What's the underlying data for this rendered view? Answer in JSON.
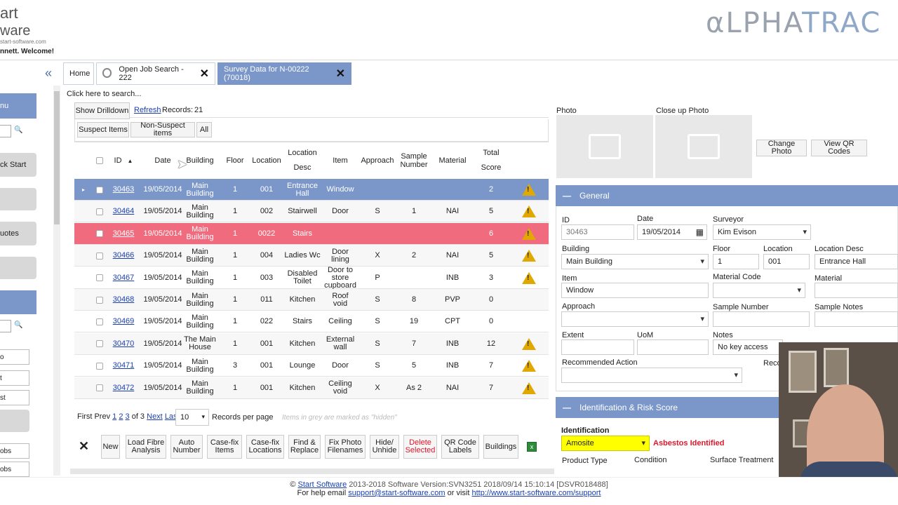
{
  "header": {
    "logo_line1": "art",
    "logo_line2": "ware",
    "logo_url": "start-software.com",
    "welcome": "nnett. Welcome!",
    "brand_a": "αLPHA",
    "brand_b": "TRAC"
  },
  "tabs": [
    {
      "label": "Home"
    },
    {
      "label": "Open Job Search - 222"
    },
    {
      "label": "Survey Data for N-00222 (70018)"
    }
  ],
  "sidebar": {
    "menu_label": "nu",
    "quick_start": "ck Start",
    "quotes": "uotes",
    "item1": "o",
    "item2": "t",
    "item3": "st",
    "item4": "obs",
    "item5": "obs"
  },
  "toolbar": {
    "click_search": "Click here to search...",
    "show_drilldown": "Show Drilldown",
    "refresh": "Refresh",
    "records_label": "Records:",
    "records_count": "21",
    "filter_suspect": "Suspect Items",
    "filter_nonsuspect": "Non-Suspect items",
    "filter_all": "All"
  },
  "table": {
    "headers": {
      "id": "ID",
      "date": "Date",
      "building": "Building",
      "floor": "Floor",
      "location": "Location",
      "location_desc": "Location Desc",
      "item": "Item",
      "approach": "Approach",
      "sample": "Sample Number",
      "material": "Material",
      "score": "Total Score"
    },
    "rows": [
      {
        "id": "30463",
        "date": "19/05/2014",
        "building": "Main Building",
        "floor": "1",
        "location": "001",
        "desc": "Entrance Hall",
        "item": "Window",
        "approach": "",
        "sample": "",
        "material": "",
        "score": "2",
        "warn": true
      },
      {
        "id": "30464",
        "date": "19/05/2014",
        "building": "Main Building",
        "floor": "1",
        "location": "002",
        "desc": "Stairwell",
        "item": "Door",
        "approach": "S",
        "sample": "1",
        "material": "NAI",
        "score": "5",
        "warn": true
      },
      {
        "id": "30465",
        "date": "19/05/2014",
        "building": "Main Building",
        "floor": "1",
        "location": "0022",
        "desc": "Stairs",
        "item": "",
        "approach": "",
        "sample": "",
        "material": "",
        "score": "6",
        "warn": true
      },
      {
        "id": "30466",
        "date": "19/05/2014",
        "building": "Main Building",
        "floor": "1",
        "location": "004",
        "desc": "Ladies Wc",
        "item": "Door lining",
        "approach": "X",
        "sample": "2",
        "material": "NAI",
        "score": "5",
        "warn": true
      },
      {
        "id": "30467",
        "date": "19/05/2014",
        "building": "Main Building",
        "floor": "1",
        "location": "003",
        "desc": "Disabled Toilet",
        "item": "Door to store cupboard",
        "approach": "P",
        "sample": "",
        "material": "INB",
        "score": "3",
        "warn": true
      },
      {
        "id": "30468",
        "date": "19/05/2014",
        "building": "Main Building",
        "floor": "1",
        "location": "011",
        "desc": "Kitchen",
        "item": "Roof void",
        "approach": "S",
        "sample": "8",
        "material": "PVP",
        "score": "0",
        "warn": false
      },
      {
        "id": "30469",
        "date": "19/05/2014",
        "building": "Main Building",
        "floor": "1",
        "location": "022",
        "desc": "Stairs",
        "item": "Ceiling",
        "approach": "S",
        "sample": "19",
        "material": "CPT",
        "score": "0",
        "warn": false
      },
      {
        "id": "30470",
        "date": "19/05/2014",
        "building": "The Main House",
        "floor": "1",
        "location": "001",
        "desc": "Kitchen",
        "item": "External wall",
        "approach": "S",
        "sample": "7",
        "material": "INB",
        "score": "12",
        "warn": true
      },
      {
        "id": "30471",
        "date": "19/05/2014",
        "building": "Main Building",
        "floor": "3",
        "location": "001",
        "desc": "Lounge",
        "item": "Door",
        "approach": "S",
        "sample": "5",
        "material": "INB",
        "score": "7",
        "warn": true
      },
      {
        "id": "30472",
        "date": "19/05/2014",
        "building": "Main Building",
        "floor": "1",
        "location": "001",
        "desc": "Kitchen",
        "item": "Ceiling void",
        "approach": "X",
        "sample": "As 2",
        "material": "NAI",
        "score": "7",
        "warn": true
      }
    ]
  },
  "pager": {
    "first": "First",
    "prev": "Prev",
    "p1": "1",
    "p2": "2",
    "p3": "3",
    "of": "of 3",
    "next": "Next",
    "last": "Last",
    "per_page_value": "10",
    "per_page_label": "Records per page",
    "hint": "Items in grey are marked as \"hidden\""
  },
  "actions": {
    "new": "New",
    "load_fibre": "Load Fibre Analysis",
    "auto_number": "Auto Number",
    "casefix_items": "Case-fix Items",
    "casefix_locations": "Case-fix Locations",
    "find_replace": "Find & Replace",
    "fix_photo": "Fix Photo Filenames",
    "hide_unhide": "Hide/ Unhide",
    "delete_selected": "Delete Selected",
    "qr_labels": "QR Code Labels",
    "buildings": "Buildings"
  },
  "photos": {
    "photo_label": "Photo",
    "closeup_label": "Close up Photo",
    "change_photo": "Change Photo",
    "view_qr": "View QR Codes"
  },
  "general": {
    "title": "General",
    "id_label": "ID",
    "id_value": "30463",
    "date_label": "Date",
    "date_value": "19/05/2014",
    "surveyor_label": "Surveyor",
    "surveyor_value": "Kim Evison",
    "building_label": "Building",
    "building_value": "Main Building",
    "floor_label": "Floor",
    "floor_value": "1",
    "location_label": "Location",
    "location_value": "001",
    "locdesc_label": "Location Desc",
    "locdesc_value": "Entrance Hall",
    "item_label": "Item",
    "item_value": "Window",
    "matcode_label": "Material Code",
    "material_label": "Material",
    "approach_label": "Approach",
    "sample_label": "Sample Number",
    "samplenotes_label": "Sample Notes",
    "extent_label": "Extent",
    "uom_label": "UoM",
    "notes_label": "Notes",
    "notes_value": "No key access",
    "recaction_label": "Recommended Action",
    "reco_label": "Reco"
  },
  "identification": {
    "title": "Identification & Risk Score",
    "ident_label": "Identification",
    "ident_value": "Amosite",
    "status": "Asbestos Identified",
    "product_label": "Product Type",
    "condition_label": "Condition",
    "surface_label": "Surface Treatment"
  },
  "footer": {
    "copyright": "©",
    "company": "Start Software",
    "line1_rest": "2013-2018 Software Version:SVN3251 2018/09/14 15:10:14 [DSVR018488]",
    "help_text": "For help email",
    "email": "support@start-software.com",
    "or_visit": "or visit",
    "url": "http://www.start-software.com/support"
  },
  "colors": {
    "accent": "#7b97c9",
    "selected_row": "#7b97c9",
    "error_row": "#f06b7d",
    "warning": "#e0a800",
    "identified_bg": "#ffff00",
    "identified_text": "#e0152a"
  }
}
